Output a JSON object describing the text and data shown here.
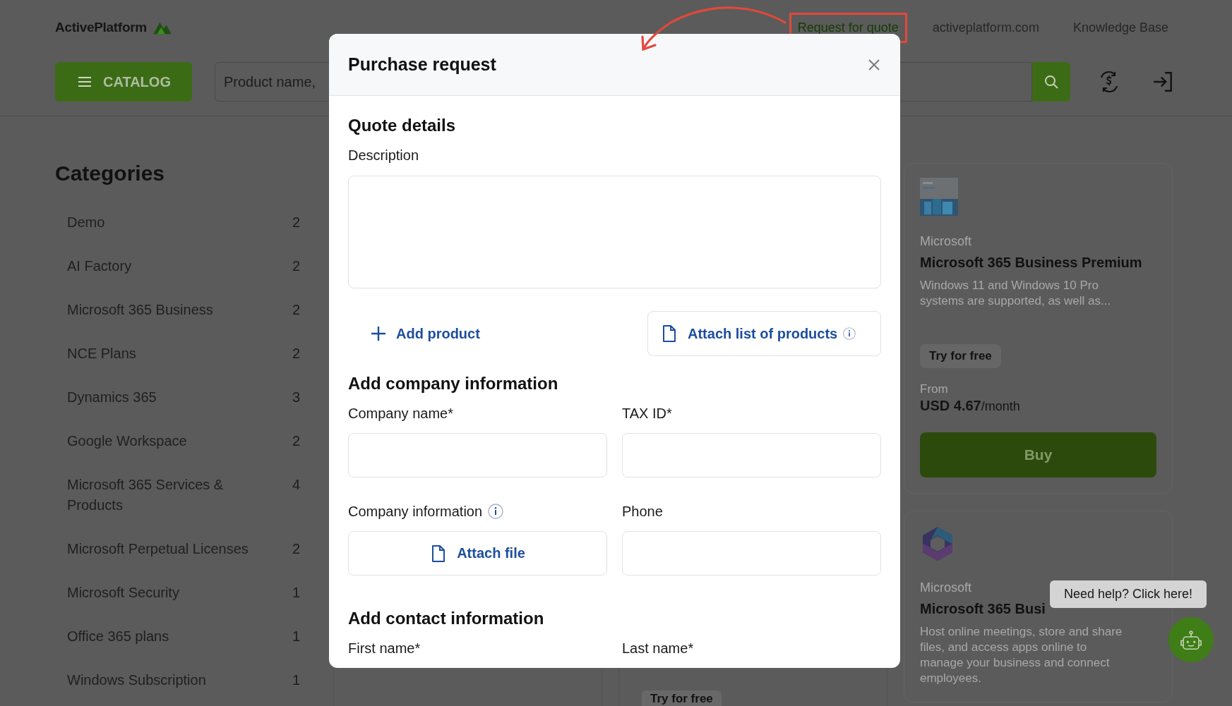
{
  "header": {
    "logo": "ActivePlatform",
    "links": [
      {
        "label": "Request for quote",
        "accent": true,
        "annotated": true
      },
      {
        "label": "activeplatform.com",
        "accent": false,
        "annotated": false
      },
      {
        "label": "Knowledge Base",
        "accent": false,
        "annotated": false
      }
    ],
    "catalog_button": "CATALOG",
    "search": {
      "placeholder": "Product name,"
    }
  },
  "sidebar": {
    "title": "Categories",
    "items": [
      {
        "label": "Demo",
        "count": "2"
      },
      {
        "label": "AI Factory",
        "count": "2"
      },
      {
        "label": "Microsoft 365 Business",
        "count": "2"
      },
      {
        "label": "NCE Plans",
        "count": "2"
      },
      {
        "label": "Dynamics 365",
        "count": "3"
      },
      {
        "label": "Google Workspace",
        "count": "2"
      },
      {
        "label": "Microsoft 365 Services & Products",
        "count": "4"
      },
      {
        "label": "Microsoft Perpetual Licenses",
        "count": "2"
      },
      {
        "label": "Microsoft Security",
        "count": "1"
      },
      {
        "label": "Office 365 plans",
        "count": "1"
      },
      {
        "label": "Windows Subscription",
        "count": "1"
      }
    ]
  },
  "partial_cards": [
    {
      "kind": "blank"
    },
    {
      "kind": "chip",
      "try_label": "Try for free"
    }
  ],
  "product_cards": [
    {
      "kind": "boxshot",
      "vendor": "Microsoft",
      "title": "Microsoft 365 Business Premium",
      "description": "Windows 11 and Windows 10 Pro systems are supported, as well as...",
      "try_label": "Try for free",
      "price_prefix": "From",
      "price": "USD 4.67",
      "price_unit": "/month",
      "buy_label": "Buy"
    },
    {
      "kind": "logo",
      "vendor": "Microsoft",
      "title": "Microsoft 365 Busi",
      "description": "Host online meetings, store and share files, and access apps online to manage your business and connect employees."
    }
  ],
  "modal": {
    "title": "Purchase request",
    "blocks": [
      {
        "kind": "heading",
        "text": "Quote details"
      },
      {
        "kind": "textarea",
        "label": "Description"
      },
      {
        "kind": "product_actions",
        "add_label": "Add product",
        "attach_label": "Attach list of products",
        "info": true
      },
      {
        "kind": "heading",
        "text": "Add company information"
      },
      {
        "kind": "pair",
        "fields": [
          {
            "kind": "input",
            "label": "Company name*"
          },
          {
            "kind": "input",
            "label": "TAX ID*"
          }
        ]
      },
      {
        "kind": "pair",
        "fields": [
          {
            "kind": "file",
            "label": "Company information",
            "info": true,
            "button": "Attach file"
          },
          {
            "kind": "input",
            "label": "Phone"
          }
        ]
      },
      {
        "kind": "heading",
        "text": "Add contact information"
      },
      {
        "kind": "pair",
        "fields": [
          {
            "kind": "label",
            "label": "First name*"
          },
          {
            "kind": "label",
            "label": "Last name*"
          }
        ]
      }
    ]
  },
  "chat": {
    "tooltip": "Need help? Click here!"
  }
}
